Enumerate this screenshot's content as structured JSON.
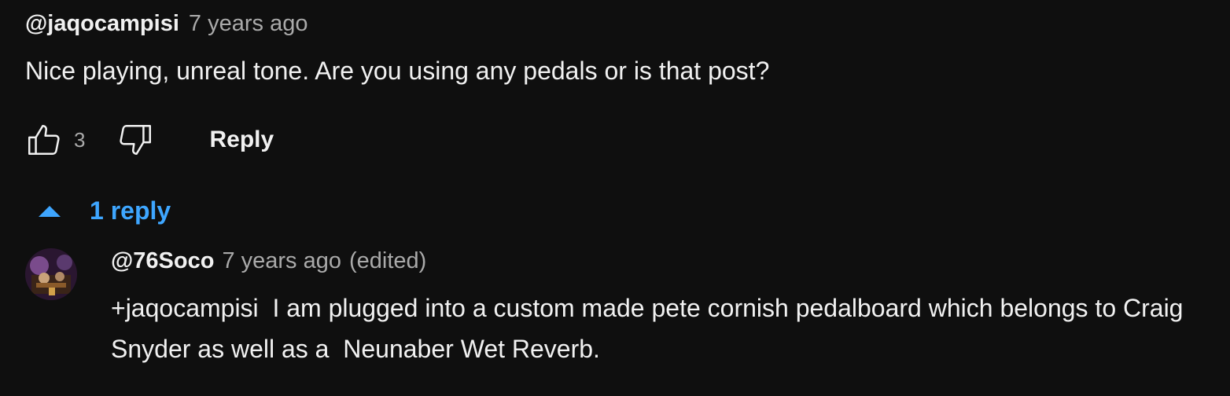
{
  "comment": {
    "author": "@jaqocampisi",
    "time": "7 years ago",
    "text": "Nice playing, unreal tone. Are you using any pedals or is that post?",
    "like_count": "3",
    "reply_label": "Reply"
  },
  "replies_toggle": {
    "label": "1 reply",
    "icon": "caret-up-icon"
  },
  "reply": {
    "author": "@76Soco",
    "time": "7 years ago",
    "edited": "(edited)",
    "text": "+jaqocampisi  I am plugged into a custom made pete cornish pedalboard which belongs to Craig Snyder as well as a  Neunaber Wet Reverb."
  },
  "colors": {
    "background": "#0f0f0f",
    "text": "#f1f1f1",
    "secondary": "#aaaaaa",
    "link_blue": "#3ea6ff"
  }
}
